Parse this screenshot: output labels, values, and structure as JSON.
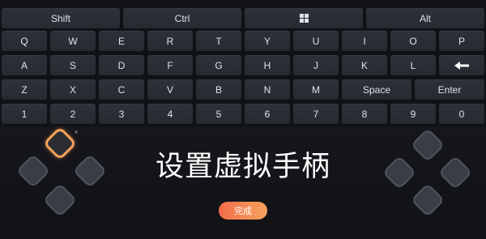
{
  "keyboard": {
    "modifiers": [
      "Shift",
      "Ctrl",
      "windows-icon",
      "Alt"
    ],
    "row_letters_1": [
      "Q",
      "W",
      "E",
      "R",
      "T",
      "Y",
      "U",
      "I",
      "O",
      "P"
    ],
    "row_letters_2": [
      "A",
      "S",
      "D",
      "F",
      "G",
      "H",
      "J",
      "K",
      "L",
      "backspace-arrow-icon"
    ],
    "row_letters_3": [
      "Z",
      "X",
      "C",
      "V",
      "B",
      "N",
      "M",
      "Space",
      "Enter"
    ],
    "row_numbers": [
      "1",
      "2",
      "3",
      "4",
      "5",
      "6",
      "7",
      "8",
      "9",
      "0"
    ]
  },
  "gamepad": {
    "title": "设置虚拟手柄",
    "done_label": "完成",
    "close_symbol": "×",
    "left_dpad_icon": "dpad-left-cluster",
    "right_dpad_icon": "dpad-right-cluster"
  },
  "colors": {
    "accent_start": "#f26b4a",
    "accent_end": "#f6a35c",
    "active_outline": "#f5a15a",
    "key_bg": "#2d3139"
  }
}
